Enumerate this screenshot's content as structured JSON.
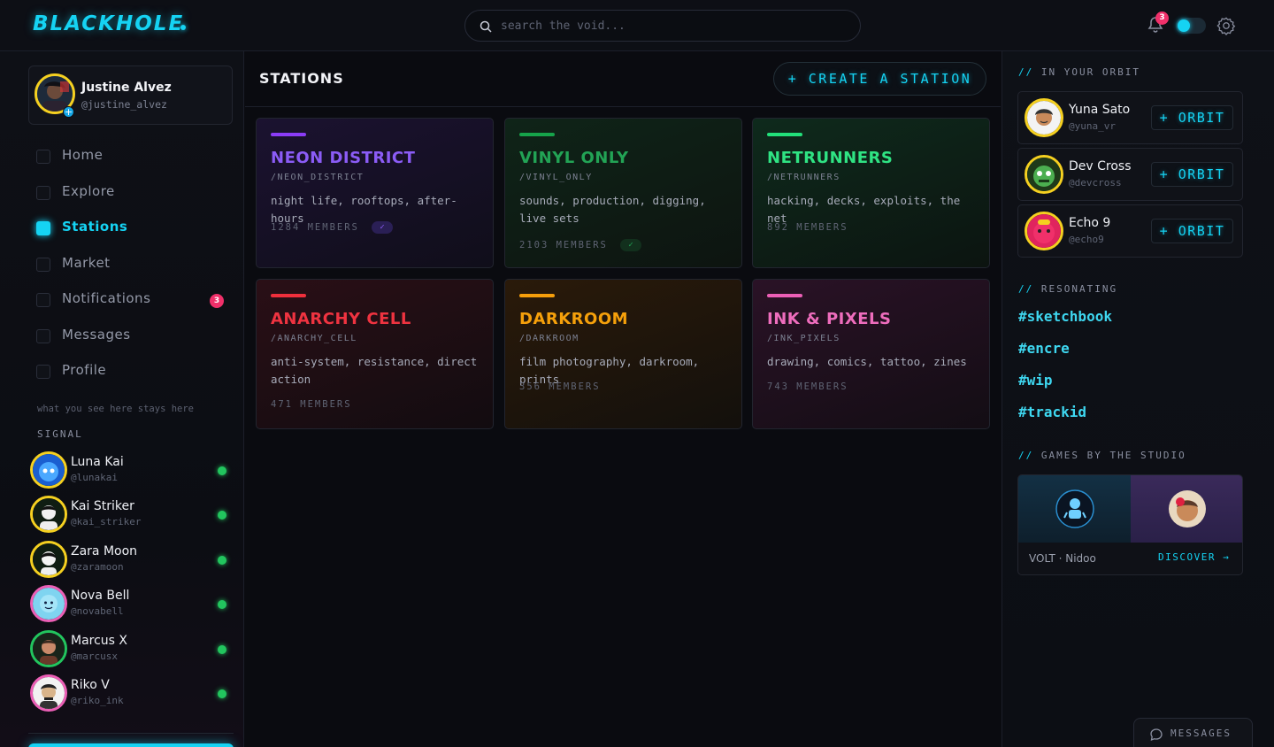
{
  "brand": {
    "logo": "BLACKHOLE",
    "accent": "#15d3f3"
  },
  "search": {
    "placeholder": "search the void..."
  },
  "header": {
    "notification_count": "3"
  },
  "user": {
    "name": "Justine Alvez",
    "handle": "@justine_alvez"
  },
  "nav": {
    "items": [
      {
        "label": "Home"
      },
      {
        "label": "Explore"
      },
      {
        "label": "Stations"
      },
      {
        "label": "Market"
      },
      {
        "label": "Notifications",
        "badge": "3"
      },
      {
        "label": "Messages"
      },
      {
        "label": "Profile"
      }
    ],
    "active": "Stations"
  },
  "sidebar": {
    "tagline": "what you see here stays here",
    "signal_title": "SIGNAL",
    "friends": [
      {
        "name": "Luna Kai",
        "handle": "@lunakai"
      },
      {
        "name": "Kai Striker",
        "handle": "@kai_striker"
      },
      {
        "name": "Zara Moon",
        "handle": "@zaramoon"
      },
      {
        "name": "Nova Bell",
        "handle": "@novabell"
      },
      {
        "name": "Marcus X",
        "handle": "@marcusx"
      },
      {
        "name": "Riko V",
        "handle": "@riko_ink"
      }
    ]
  },
  "main": {
    "title": "STATIONS",
    "create_label": "+ CREATE A STATION",
    "stations": [
      {
        "name": "NEON DISTRICT",
        "slug": "/NEON_DISTRICT",
        "desc": "night life, rooftops, after-hours",
        "members": "1284 MEMBERS",
        "joined": true,
        "color": "#8b3cf7"
      },
      {
        "name": "VINYL ONLY",
        "slug": "/VINYL_ONLY",
        "desc": "sounds, production, digging, live sets",
        "members": "2103 MEMBERS",
        "joined": true,
        "color": "#16a34a"
      },
      {
        "name": "NETRUNNERS",
        "slug": "/NETRUNNERS",
        "desc": "hacking, decks, exploits, the net",
        "members": "892 MEMBERS",
        "joined": false,
        "color": "#22e07a"
      },
      {
        "name": "ANARCHY CELL",
        "slug": "/ANARCHY_CELL",
        "desc": "anti-system, resistance, direct action",
        "members": "471 MEMBERS",
        "joined": false,
        "color": "#ef2f3c"
      },
      {
        "name": "DARKROOM",
        "slug": "/DARKROOM",
        "desc": "film photography, darkroom, prints",
        "members": "356 MEMBERS",
        "joined": false,
        "color": "#f59e0b"
      },
      {
        "name": "INK & PIXELS",
        "slug": "/INK_PIXELS",
        "desc": "drawing, comics, tattoo, zines",
        "members": "743 MEMBERS",
        "joined": false,
        "color": "#ec5fb6"
      }
    ],
    "check_glyph": "✓"
  },
  "right": {
    "orbit_title": "IN YOUR ORBIT",
    "slashes": "//",
    "orbit": [
      {
        "name": "Yuna Sato",
        "handle": "@yuna_vr",
        "action": "+ ORBIT"
      },
      {
        "name": "Dev Cross",
        "handle": "@devcross",
        "action": "+ ORBIT"
      },
      {
        "name": "Echo 9",
        "handle": "@echo9",
        "action": "+ ORBIT"
      }
    ],
    "resonating_title": "RESONATING",
    "hashtags": [
      "#sketchbook",
      "#encre",
      "#wip",
      "#trackid"
    ],
    "games_title": "GAMES BY THE STUDIO",
    "games_names": "VOLT · Nidoo",
    "discover_label": "DISCOVER →",
    "messages_label": "MESSAGES"
  }
}
